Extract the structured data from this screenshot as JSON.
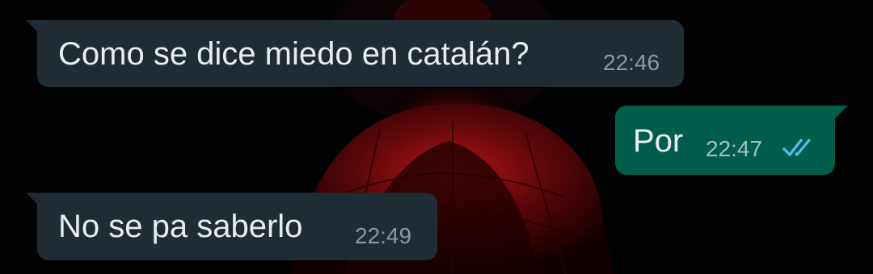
{
  "colors": {
    "incoming_bubble": "#1f2c33",
    "outgoing_bubble": "#005c4b",
    "message_text": "#e9edef",
    "timestamp": "#8d999f",
    "read_ticks": "#53bdeb"
  },
  "messages": [
    {
      "direction": "incoming",
      "text": "Como se dice miedo en catalán?",
      "time": "22:46"
    },
    {
      "direction": "outgoing",
      "text": "Por",
      "time": "22:47",
      "status_icon": "double-check-read-icon"
    },
    {
      "direction": "incoming",
      "text": "No se pa saberlo",
      "time": "22:49"
    }
  ]
}
